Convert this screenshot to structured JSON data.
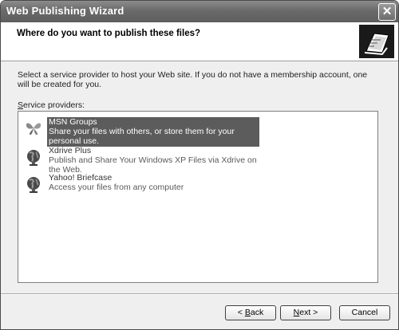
{
  "window": {
    "title": "Web Publishing Wizard",
    "close_label": "✕"
  },
  "header": {
    "title": "Where do you want to publish these files?"
  },
  "description": "Select a service provider to host your Web site.  If you do not have a membership account, one will be created for you.",
  "providers_label": "Service providers:",
  "providers": [
    {
      "name": "MSN Groups",
      "description": "Share your files with others, or store them for your personal use.",
      "icon": "butterfly-icon",
      "selected": true
    },
    {
      "name": "Xdrive Plus",
      "description": "Publish and Share Your Windows XP Files via Xdrive on the Web.",
      "icon": "globe-icon",
      "selected": false
    },
    {
      "name": "Yahoo! Briefcase",
      "description": "Access your files from any computer",
      "icon": "globe-icon",
      "selected": false
    }
  ],
  "buttons": {
    "back_prefix": "< ",
    "back_underlined": "B",
    "back_rest": "ack",
    "next_underlined": "N",
    "next_rest": "ext",
    "next_suffix": " >",
    "cancel": "Cancel"
  }
}
